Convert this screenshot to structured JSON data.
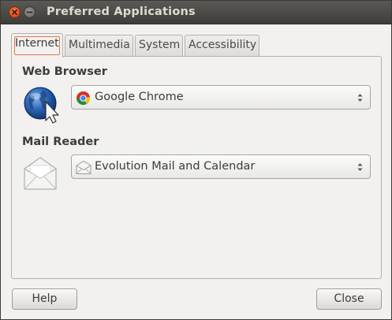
{
  "window": {
    "title": "Preferred Applications"
  },
  "tabs": [
    {
      "label": "Internet",
      "active": true
    },
    {
      "label": "Multimedia",
      "active": false
    },
    {
      "label": "System",
      "active": false
    },
    {
      "label": "Accessibility",
      "active": false
    }
  ],
  "internet": {
    "web_browser": {
      "heading": "Web Browser",
      "icon": "globe-cursor-icon",
      "selected": "Google Chrome",
      "selected_icon": "chrome-icon"
    },
    "mail_reader": {
      "heading": "Mail Reader",
      "icon": "envelope-icon",
      "selected": "Evolution Mail and Calendar",
      "selected_icon": "envelope-icon"
    }
  },
  "buttons": {
    "help": "Help",
    "close": "Close"
  },
  "colors": {
    "titlebar": "#3e3d39",
    "close_button": "#e0501e",
    "focus_ring": "#e4784a",
    "window_bg": "#f2f1f0"
  }
}
